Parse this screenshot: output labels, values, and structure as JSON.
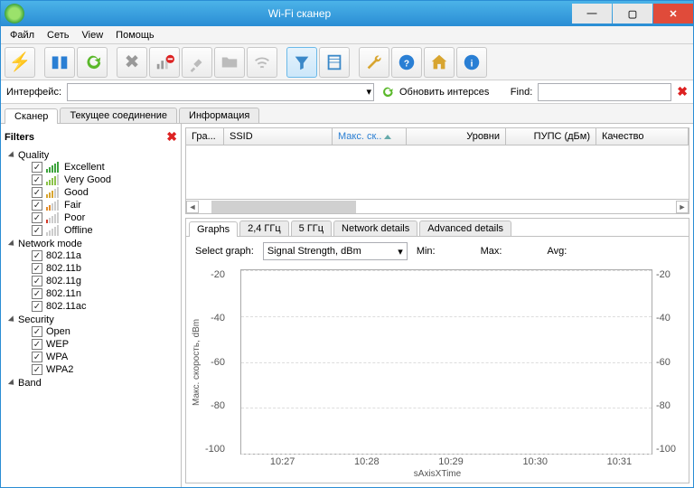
{
  "window": {
    "title": "Wi-Fi сканер"
  },
  "menu": {
    "file": "Файл",
    "net": "Сеть",
    "view": "View",
    "help": "Помощь"
  },
  "iface": {
    "label": "Интерфейс:",
    "refresh": "Обновить интерсеs",
    "find": "Find:"
  },
  "tabs": {
    "scanner": "Сканер",
    "conn": "Текущее соединение",
    "info": "Информация"
  },
  "filters": {
    "title": "Filters",
    "groups": {
      "quality": {
        "label": "Quality",
        "items": [
          "Excellent",
          "Very Good",
          "Good",
          "Fair",
          "Poor",
          "Offline"
        ]
      },
      "mode": {
        "label": "Network mode",
        "items": [
          "802.11a",
          "802.11b",
          "802.11g",
          "802.11n",
          "802.11ac"
        ]
      },
      "security": {
        "label": "Security",
        "items": [
          "Open",
          "WEP",
          "WPA",
          "WPA2"
        ]
      },
      "band": {
        "label": "Band"
      }
    }
  },
  "grid": {
    "cols": [
      "Гра...",
      "SSID",
      "Макс. ск..",
      "Уровни",
      "ПУПС (дБм)",
      "Качество"
    ]
  },
  "subtabs": {
    "graphs": "Graphs",
    "g24": "2,4 ГГц",
    "g5": "5 ГГц",
    "net": "Network details",
    "adv": "Advanced details"
  },
  "graph": {
    "select_label": "Select graph:",
    "select_value": "Signal Strength, dBm",
    "min": "Min:",
    "max": "Max:",
    "avg": "Avg:",
    "ylabel": "Макс. скорость, dBm",
    "xlabel": "sAxisXTime"
  },
  "chart_data": {
    "type": "line",
    "title": "Signal Strength, dBm",
    "ylabel": "Макс. скорость, dBm",
    "xlabel": "sAxisXTime",
    "ylim": [
      -100,
      -20
    ],
    "yticks": [
      -20,
      -40,
      -60,
      -80,
      -100
    ],
    "xticks": [
      "10:27",
      "10:28",
      "10:29",
      "10:30",
      "10:31"
    ],
    "series": []
  }
}
